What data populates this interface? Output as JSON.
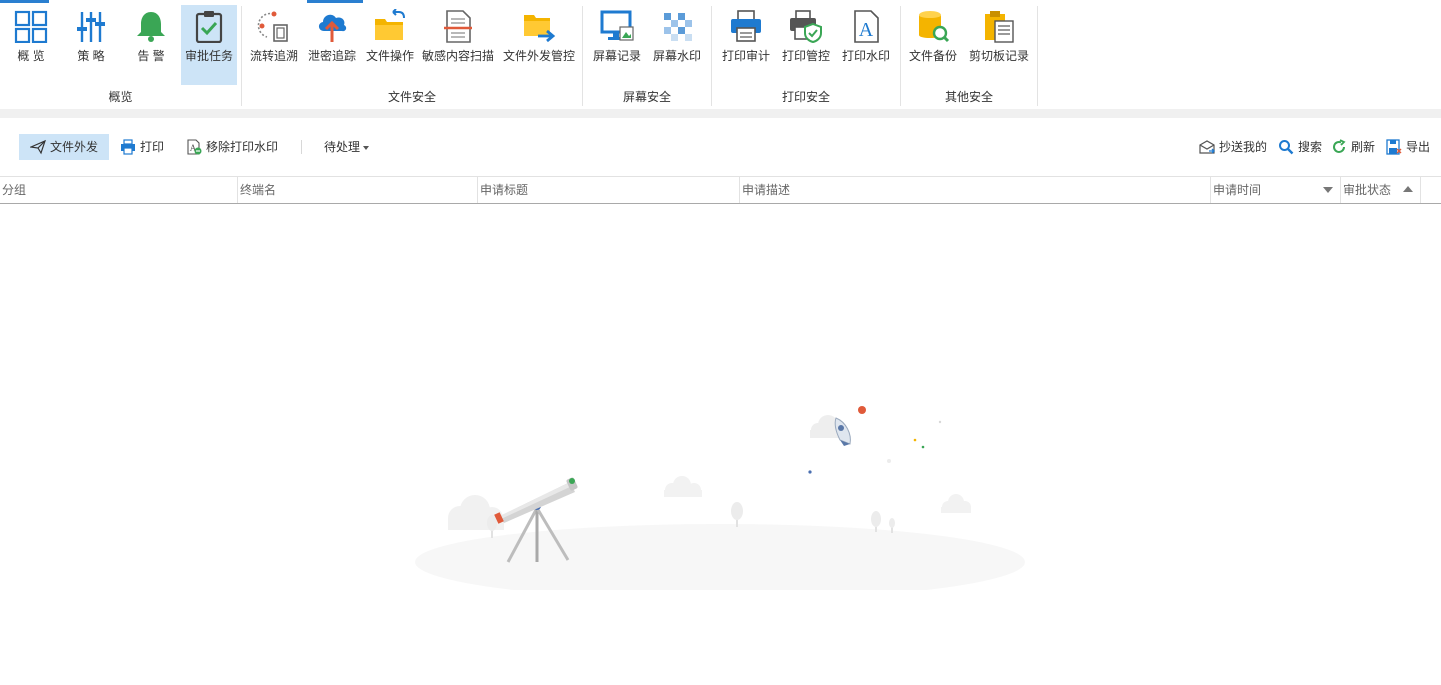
{
  "ribbon": {
    "groups": [
      {
        "label": "概览",
        "buttons": [
          {
            "label": "概 览",
            "icon": "grid-icon"
          },
          {
            "label": "策 略",
            "icon": "sliders-icon"
          },
          {
            "label": "告 警",
            "icon": "bell-icon"
          },
          {
            "label": "审批任务",
            "icon": "clipboard-check-icon",
            "active": true
          }
        ]
      },
      {
        "label": "文件安全",
        "buttons": [
          {
            "label": "流转追溯",
            "icon": "file-trace-icon"
          },
          {
            "label": "泄密追踪",
            "icon": "cloud-upload-icon"
          },
          {
            "label": "文件操作",
            "icon": "folder-icon"
          },
          {
            "label": "敏感内容扫描",
            "icon": "document-scan-icon"
          },
          {
            "label": "文件外发管控",
            "icon": "folder-send-icon"
          }
        ]
      },
      {
        "label": "屏幕安全",
        "buttons": [
          {
            "label": "屏幕记录",
            "icon": "monitor-icon"
          },
          {
            "label": "屏幕水印",
            "icon": "watermark-icon"
          }
        ]
      },
      {
        "label": "打印安全",
        "buttons": [
          {
            "label": "打印审计",
            "icon": "printer-icon"
          },
          {
            "label": "打印管控",
            "icon": "printer-shield-icon"
          },
          {
            "label": "打印水印",
            "icon": "font-a-icon"
          }
        ]
      },
      {
        "label": "其他安全",
        "buttons": [
          {
            "label": "文件备份",
            "icon": "database-search-icon"
          },
          {
            "label": "剪切板记录",
            "icon": "clipboard-docs-icon"
          }
        ]
      }
    ]
  },
  "toolbar": {
    "file_send": "文件外发",
    "print": "打印",
    "remove_watermark": "移除打印水印",
    "pending": "待处理",
    "cc_me": "抄送我的",
    "search": "搜索",
    "refresh": "刷新",
    "export": "导出"
  },
  "table": {
    "columns": [
      "分组",
      "终端名",
      "申请标题",
      "申请描述",
      "申请时间",
      "审批状态"
    ]
  },
  "colors": {
    "accent": "#2a7fd0",
    "active_bg": "#cde4f7",
    "icon_blue": "#1e7ad0",
    "icon_yellow": "#f4b400",
    "icon_green": "#3aa655"
  }
}
